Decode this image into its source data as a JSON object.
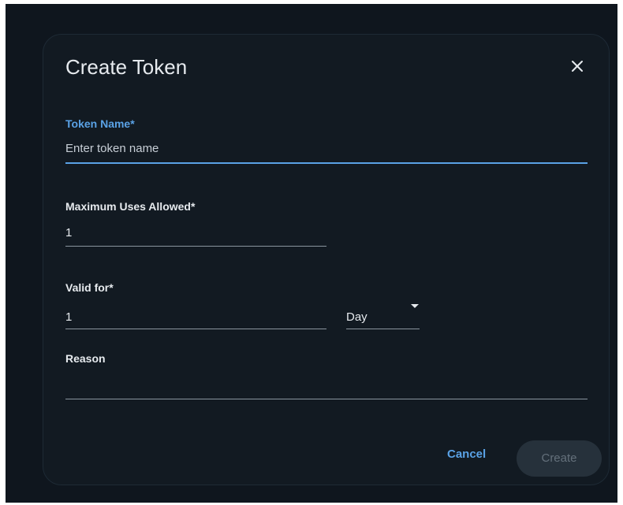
{
  "dialog": {
    "title": "Create Token",
    "close_icon": "close-icon"
  },
  "fields": {
    "token_name": {
      "label": "Token Name*",
      "value": "",
      "placeholder": "Enter token name",
      "focused": true
    },
    "max_uses": {
      "label": "Maximum Uses Allowed*",
      "value": "1"
    },
    "valid_for": {
      "label": "Valid for*",
      "value": "1",
      "unit": "Day"
    },
    "reason": {
      "label": "Reason",
      "value": ""
    }
  },
  "actions": {
    "cancel_label": "Cancel",
    "create_label": "Create"
  },
  "colors": {
    "accent": "#5aa2e6",
    "background": "#0f161e",
    "dialog": "#121a22",
    "disabled_button": "#26313b"
  }
}
